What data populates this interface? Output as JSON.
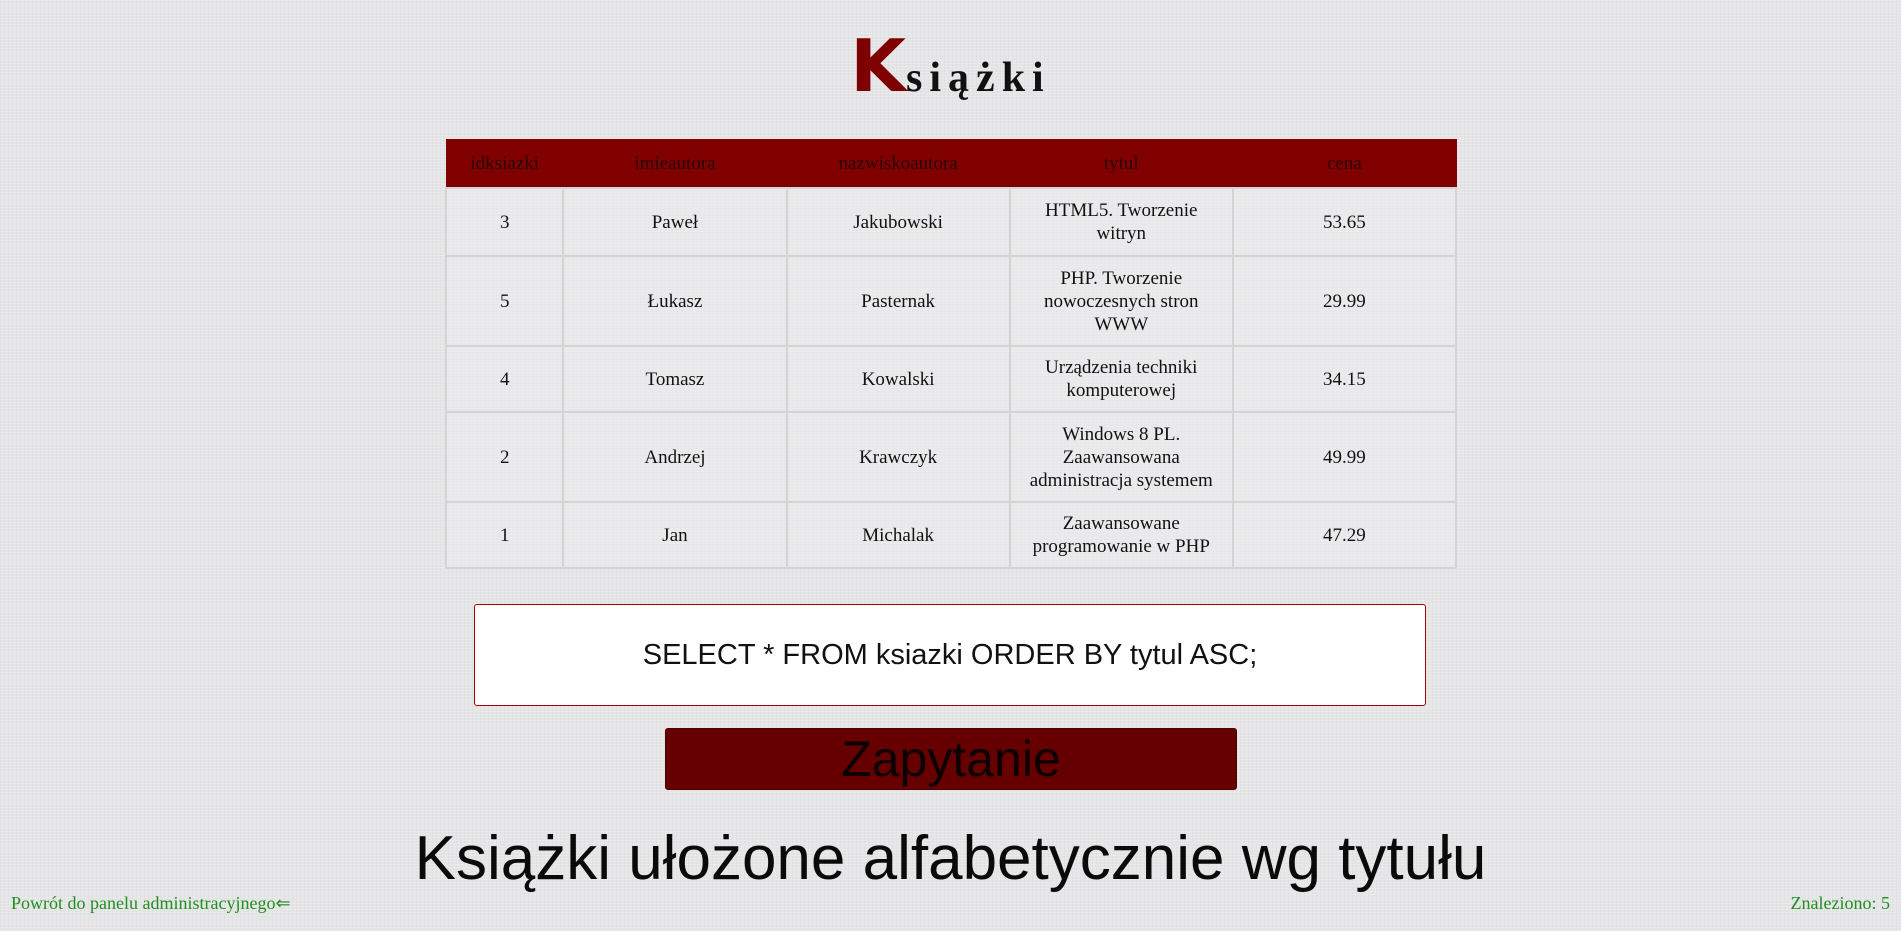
{
  "header": {
    "logo_letter": "K",
    "logo_rest": "siążki"
  },
  "table": {
    "columns": [
      "idksiazki",
      "imieautora",
      "nazwiskoautora",
      "tytul",
      "cena"
    ],
    "rows": [
      {
        "idksiazki": "3",
        "imieautora": "Paweł",
        "nazwiskoautora": "Jakubowski",
        "tytul": "HTML5. Tworzenie witryn",
        "cena": "53.65"
      },
      {
        "idksiazki": "5",
        "imieautora": "Łukasz",
        "nazwiskoautora": "Pasternak",
        "tytul": "PHP. Tworzenie nowoczesnych stron WWW",
        "cena": "29.99"
      },
      {
        "idksiazki": "4",
        "imieautora": "Tomasz",
        "nazwiskoautora": "Kowalski",
        "tytul": "Urządzenia techniki komputerowej",
        "cena": "34.15"
      },
      {
        "idksiazki": "2",
        "imieautora": "Andrzej",
        "nazwiskoautora": "Krawczyk",
        "tytul": "Windows 8 PL. Zaawansowana administracja systemem",
        "cena": "49.99"
      },
      {
        "idksiazki": "1",
        "imieautora": "Jan",
        "nazwiskoautora": "Michalak",
        "tytul": "Zaawansowane programowanie w PHP",
        "cena": "47.29"
      }
    ]
  },
  "query": {
    "value": "SELECT * FROM ksiazki ORDER BY tytul ASC;"
  },
  "submit": {
    "label": "Zapytanie"
  },
  "result": {
    "heading": "Książki ułożone alfabetycznie wg tytułu"
  },
  "footer": {
    "back_link": "Powrót do panelu administracyjnego⇐",
    "count": "Znaleziono: 5"
  },
  "colors": {
    "accent": "#800000",
    "button": "#660000",
    "link": "#1f8f1f",
    "background": "#e5e5e7"
  }
}
